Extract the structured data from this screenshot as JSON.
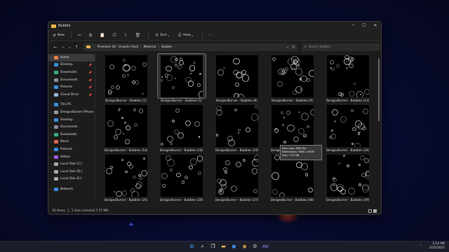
{
  "window": {
    "title": "Bubble",
    "controls": {
      "minimize": "─",
      "maximize": "☐",
      "close": "✕"
    }
  },
  "toolbar": {
    "new_label": "New",
    "sort_label": "Sort",
    "view_label": "View",
    "more_label": "···"
  },
  "address": {
    "crumbs": [
      "Premium 3K - Graphic Pack",
      "Material",
      "Bubble"
    ],
    "search_placeholder": "Search Bubble"
  },
  "nav": {
    "items": [
      {
        "label": "Home",
        "icon": "home-icon",
        "color": "#e8804a",
        "chev": "›",
        "active": true,
        "pin": ""
      },
      {
        "label": "Desktop",
        "icon": "desktop-icon",
        "color": "#3a8de0",
        "chev": "",
        "pin": "📌"
      },
      {
        "label": "Downloads",
        "icon": "downloads-icon",
        "color": "#3ab07a",
        "chev": "",
        "pin": "📌"
      },
      {
        "label": "Documents",
        "icon": "documents-icon",
        "color": "#8a8a9a",
        "chev": "",
        "pin": "📌"
      },
      {
        "label": "Pictures",
        "icon": "pictures-icon",
        "color": "#3a8de0",
        "chev": "",
        "pin": "📌"
      },
      {
        "label": "iCloud Drive",
        "icon": "icloud-icon",
        "color": "#9ab7e0",
        "chev": "",
        "pin": "📌"
      },
      {
        "gap": true
      },
      {
        "label": "This PC",
        "icon": "pc-icon",
        "color": "#3a8de0",
        "chev": "⌄",
        "pin": ""
      },
      {
        "label": "DesignsBurner iPhone",
        "icon": "phone-icon",
        "color": "#999",
        "chev": "›",
        "pin": ""
      },
      {
        "label": "Desktop",
        "icon": "desktop-icon",
        "color": "#3a8de0",
        "chev": "›",
        "pin": ""
      },
      {
        "label": "Documents",
        "icon": "documents-icon",
        "color": "#8a8a9a",
        "chev": "›",
        "pin": ""
      },
      {
        "label": "Downloads",
        "icon": "downloads-icon",
        "color": "#3ab07a",
        "chev": "›",
        "pin": ""
      },
      {
        "label": "Music",
        "icon": "music-icon",
        "color": "#e06a4a",
        "chev": "›",
        "pin": ""
      },
      {
        "label": "Pictures",
        "icon": "pictures-icon",
        "color": "#3a8de0",
        "chev": "›",
        "pin": ""
      },
      {
        "label": "Videos",
        "icon": "videos-icon",
        "color": "#a05ae0",
        "chev": "›",
        "pin": ""
      },
      {
        "label": "Local Disk (C:)",
        "icon": "disk-icon",
        "color": "#aaa",
        "chev": "›",
        "pin": ""
      },
      {
        "label": "Local Disk (D:)",
        "icon": "disk-icon",
        "color": "#aaa",
        "chev": "›",
        "pin": ""
      },
      {
        "label": "Local Disk (E:)",
        "icon": "disk-icon",
        "color": "#aaa",
        "chev": "›",
        "pin": ""
      },
      {
        "gap": true
      },
      {
        "label": "Network",
        "icon": "network-icon",
        "color": "#3a8de0",
        "chev": "›",
        "pin": ""
      }
    ]
  },
  "files": [
    {
      "label": "DesignsBurner - Bubbles (1)",
      "selected": false
    },
    {
      "label": "DesignsBurner - Bubbles (5)",
      "selected": true
    },
    {
      "label": "DesignsBurner - Bubbles (8)",
      "selected": false
    },
    {
      "label": "DesignsBurner - Bubbles (9)",
      "selected": false
    },
    {
      "label": "DesignsBurner - Bubbles (13)",
      "selected": false
    },
    {
      "label": "DesignsBurner - Bubbles (14)",
      "selected": false
    },
    {
      "label": "DesignsBurner - Bubbles (18)",
      "selected": false
    },
    {
      "label": "DesignsBurner - Bubbles (19)",
      "selected": false
    },
    {
      "label": "DesignsBurner - Bubbles (23)",
      "selected": false
    },
    {
      "label": "DesignsBurner - Bubbles (24)",
      "selected": false
    },
    {
      "label": "DesignsBurner - Bubbles (25)",
      "selected": false
    },
    {
      "label": "DesignsBurner - Bubbles (26)",
      "selected": false
    },
    {
      "label": "DesignsBurner - Bubbles (27)",
      "selected": false
    },
    {
      "label": "DesignsBurner - Bubbles (48)",
      "selected": false
    },
    {
      "label": "DesignsBurner - Bubbles (49)",
      "selected": false
    }
  ],
  "tooltip": {
    "line1": "Item type: PNG File",
    "line2": "Dimensions: 5000 x 5000",
    "line3": "Size: 7.57 MB"
  },
  "status": {
    "count": "16 items",
    "selected": "1 item selected 7.57 MB"
  },
  "taskbar": {
    "icons": [
      {
        "name": "start-icon",
        "glyph": "⊞",
        "color": "#3aa0ff"
      },
      {
        "name": "search-icon",
        "glyph": "⌕",
        "color": "#ffffff"
      },
      {
        "name": "task-view-icon",
        "glyph": "❐",
        "color": "#ffffff"
      },
      {
        "name": "file-explorer-icon",
        "glyph": "▬",
        "color": "#e8b84a"
      },
      {
        "name": "store-icon",
        "glyph": "◼",
        "color": "#3a8de0"
      },
      {
        "name": "chrome-icon",
        "glyph": "◉",
        "color": "#e8a83a"
      },
      {
        "name": "settings-icon",
        "glyph": "⚙",
        "color": "#cccccc"
      },
      {
        "name": "after-effects-icon",
        "glyph": "Ae",
        "color": "#9a8aff"
      }
    ],
    "time": "3:14 AM",
    "date": "2/25/2022"
  }
}
